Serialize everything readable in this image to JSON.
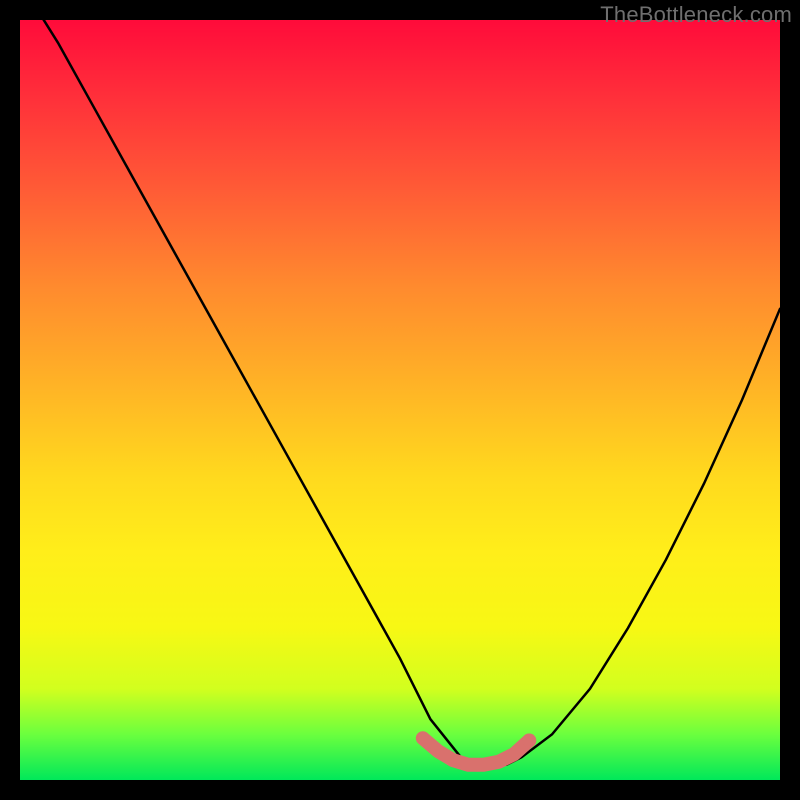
{
  "attribution": "TheBottleneck.com",
  "chart_data": {
    "type": "line",
    "title": "",
    "xlabel": "",
    "ylabel": "",
    "xlim": [
      0,
      100
    ],
    "ylim": [
      0,
      100
    ],
    "grid": false,
    "series": [
      {
        "name": "bottleneck-curve",
        "x": [
          0,
          5,
          10,
          15,
          20,
          25,
          30,
          35,
          40,
          45,
          50,
          54,
          58,
          60,
          62,
          64,
          66,
          70,
          75,
          80,
          85,
          90,
          95,
          100
        ],
        "values": [
          105,
          97,
          88,
          79,
          70,
          61,
          52,
          43,
          34,
          25,
          16,
          8,
          3,
          2,
          2,
          2,
          3,
          6,
          12,
          20,
          29,
          39,
          50,
          62
        ]
      }
    ],
    "marker_band": {
      "name": "optimal-range",
      "x": [
        53,
        55,
        57,
        59,
        61,
        63,
        65,
        67
      ],
      "values": [
        5.5,
        3.8,
        2.6,
        2.0,
        2.0,
        2.4,
        3.4,
        5.2
      ]
    },
    "colors": {
      "curve": "#000000",
      "marker": "#d9716d"
    }
  }
}
